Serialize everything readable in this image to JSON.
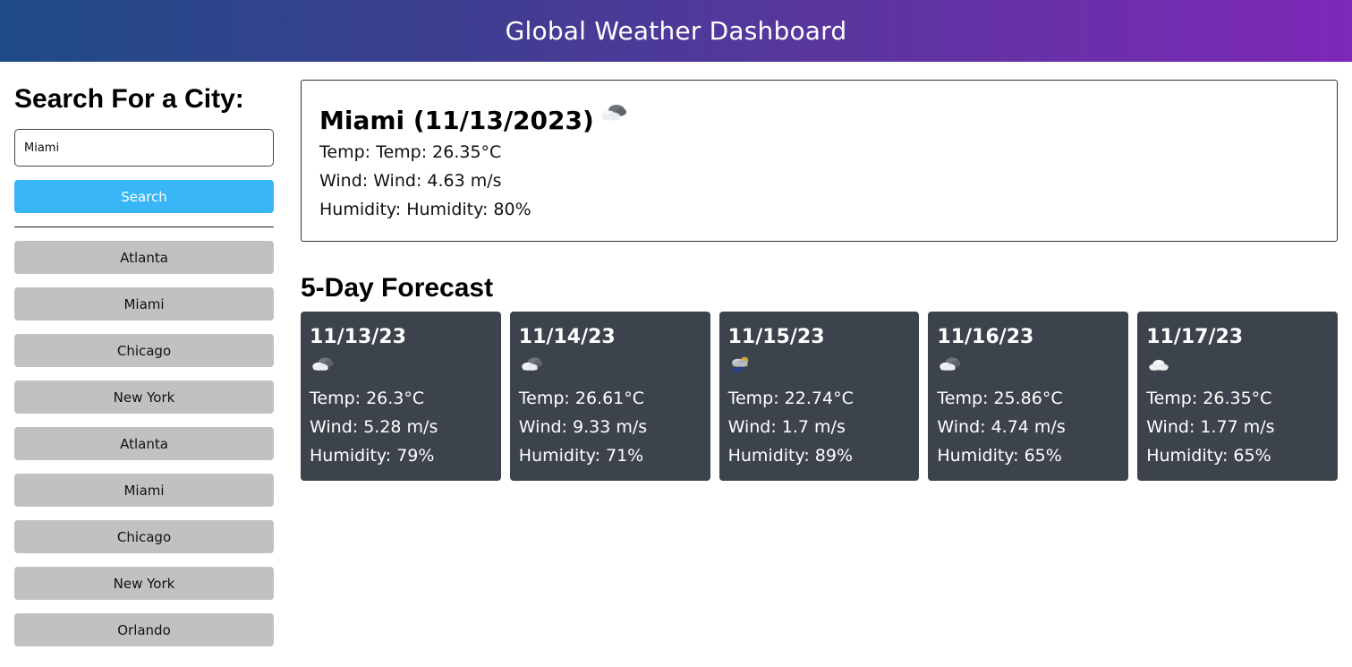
{
  "header": {
    "title": "Global Weather Dashboard"
  },
  "sidebar": {
    "heading": "Search For a City:",
    "search_value": "Miami",
    "search_button": "Search",
    "history": [
      "Atlanta",
      "Miami",
      "Chicago",
      "New York",
      "Atlanta",
      "Miami",
      "Chicago",
      "New York",
      "Orlando"
    ]
  },
  "current": {
    "title": "Miami (11/13/2023)",
    "icon": "broken-clouds-icon",
    "temp": "Temp: Temp: 26.35°C",
    "wind": "Wind: Wind: 4.63 m/s",
    "humidity": "Humidity: Humidity: 80%"
  },
  "forecast": {
    "title": "5-Day Forecast",
    "days": [
      {
        "date": "11/13/23",
        "icon": "broken-clouds-icon",
        "temp": "Temp: 26.3°C",
        "wind": "Wind: 5.28 m/s",
        "humidity": "Humidity: 79%"
      },
      {
        "date": "11/14/23",
        "icon": "broken-clouds-icon",
        "temp": "Temp: 26.61°C",
        "wind": "Wind: 9.33 m/s",
        "humidity": "Humidity: 71%"
      },
      {
        "date": "11/15/23",
        "icon": "rain-icon",
        "temp": "Temp: 22.74°C",
        "wind": "Wind: 1.7 m/s",
        "humidity": "Humidity: 89%"
      },
      {
        "date": "11/16/23",
        "icon": "broken-clouds-icon",
        "temp": "Temp: 25.86°C",
        "wind": "Wind: 4.74 m/s",
        "humidity": "Humidity: 65%"
      },
      {
        "date": "11/17/23",
        "icon": "overcast-clouds-icon",
        "temp": "Temp: 26.35°C",
        "wind": "Wind: 1.77 m/s",
        "humidity": "Humidity: 65%"
      }
    ]
  },
  "colors": {
    "header_gradient_start": "#1e4b85",
    "header_gradient_end": "#7d28b8",
    "search_button": "#38b6f6",
    "history_button": "#c1c1c1",
    "forecast_card": "#3d434d"
  }
}
